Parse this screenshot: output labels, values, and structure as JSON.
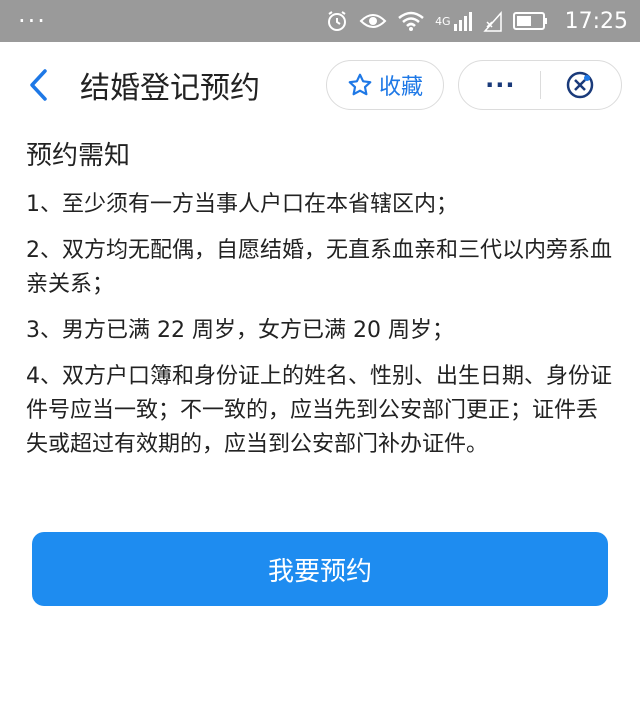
{
  "statusbar": {
    "left_text": "···",
    "network_label": "4G",
    "time": "17:25",
    "icons": [
      "alarm-icon",
      "eye-icon",
      "wifi-icon",
      "signal-icon",
      "no-signal-icon",
      "battery-icon"
    ]
  },
  "nav": {
    "title": "结婚登记预约",
    "favorite_label": "收藏",
    "menu_label": "···",
    "icons": [
      "back-arrow-icon",
      "star-icon",
      "close-circle-icon"
    ]
  },
  "notice": {
    "title": "预约需知",
    "items": [
      "1、至少须有一方当事人户口在本省辖区内；",
      "2、双方均无配偶，自愿结婚，无直系血亲和三代以内旁系血亲关系；",
      "3、男方已满 22 周岁，女方已满 20 周岁；",
      "4、双方户口簿和身份证上的姓名、性别、出生日期、身份证件号应当一致；不一致的，应当先到公安部门更正；证件丢失或超过有效期的，应当到公安部门补办证件。"
    ]
  },
  "action": {
    "reserve_label": "我要预约"
  },
  "colors": {
    "statusbar_bg": "#9a9a9a",
    "accent": "#1e78e6",
    "button_bg": "#1e8cf0"
  }
}
